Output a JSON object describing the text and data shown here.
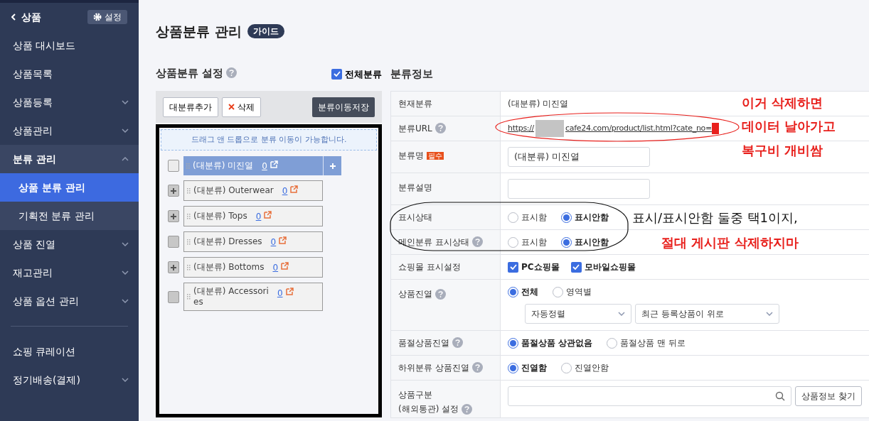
{
  "sidebar": {
    "back_label": "상품",
    "settings_label": "설정",
    "items": [
      {
        "label": "상품 대시보드"
      },
      {
        "label": "상품목록"
      },
      {
        "label": "상품등록",
        "expanded": false
      },
      {
        "label": "상품관리",
        "expanded": false
      },
      {
        "label": "분류 관리",
        "expanded": true,
        "children": [
          {
            "label": "상품 분류 관리",
            "selected": true
          },
          {
            "label": "기획전 분류 관리",
            "selected": false
          }
        ]
      },
      {
        "label": "상품 진열",
        "expanded": false
      },
      {
        "label": "재고관리",
        "expanded": false
      },
      {
        "label": "상품 옵션 관리",
        "expanded": false
      }
    ],
    "items_after_divider": [
      {
        "label": "쇼핑 큐레이션"
      },
      {
        "label": "정기배송(결제)",
        "expanded": false
      }
    ]
  },
  "page": {
    "title": "상품분류 관리",
    "guide_badge": "가이드"
  },
  "tree_panel": {
    "title": "상품분류 설정",
    "all_checkbox": {
      "label": "전체분류",
      "checked": true
    },
    "buttons": [
      {
        "label": "대분류추가"
      },
      {
        "label": "삭제"
      }
    ],
    "save_button": "분류이동저장",
    "hint": "드래그 앤 드롭으로 분류 이동이 가능합니다.",
    "nodes": [
      {
        "label": "(대분류) 미진열",
        "count": "0",
        "selected": true,
        "has_children": false
      },
      {
        "label": "(대분류) Outerwear",
        "count": "0",
        "selected": false,
        "has_children": true
      },
      {
        "label": "(대분류) Tops",
        "count": "0",
        "selected": false,
        "has_children": true
      },
      {
        "label": "(대분류) Dresses",
        "count": "0",
        "selected": false,
        "has_children": false
      },
      {
        "label": "(대분류) Bottoms",
        "count": "0",
        "selected": false,
        "has_children": true
      },
      {
        "label": "(대분류) Accessori\nes",
        "count": "0",
        "selected": false,
        "has_children": false
      }
    ]
  },
  "info_panel": {
    "title": "분류정보",
    "rows": [
      {
        "kind": "text",
        "label": "현재분류",
        "value": "(대분류) 미진열"
      },
      {
        "kind": "link",
        "label": "분류URL",
        "help": true,
        "url_start": "https://",
        "url_end": "cafe24.com/product/list.html?cate_no="
      },
      {
        "kind": "input",
        "label": "분류명",
        "required_badge": "필수",
        "value": "(대분류) 미진열"
      },
      {
        "kind": "input",
        "label": "분류설명",
        "value": ""
      },
      {
        "kind": "radio",
        "label": "표시상태",
        "options": [
          {
            "label": "표시함",
            "selected": false
          },
          {
            "label": "표시안함",
            "selected": true
          }
        ]
      },
      {
        "kind": "radio",
        "label": "메인분류 표시상태",
        "help": true,
        "options": [
          {
            "label": "표시함",
            "selected": false
          },
          {
            "label": "표시안함",
            "selected": true
          }
        ]
      },
      {
        "kind": "checkbox",
        "label": "쇼핑몰 표시설정",
        "options": [
          {
            "label": "PC쇼핑몰",
            "checked": true
          },
          {
            "label": "모바일쇼핑몰",
            "checked": true
          }
        ]
      },
      {
        "kind": "display",
        "label": "상품진열",
        "help": true,
        "options": [
          {
            "label": "전체",
            "selected": true
          },
          {
            "label": "영역별",
            "selected": false
          }
        ],
        "selects": [
          "자동정렬",
          "최근 등록상품이 위로"
        ]
      },
      {
        "kind": "radio",
        "label": "품절상품진열",
        "help": true,
        "options": [
          {
            "label": "품절상품 상관없음",
            "selected": true
          },
          {
            "label": "품절상품 맨 뒤로",
            "selected": false
          }
        ]
      },
      {
        "kind": "radio",
        "label": "하위분류 상품진열",
        "help": true,
        "options": [
          {
            "label": "진열함",
            "selected": true
          },
          {
            "label": "진열안함",
            "selected": false
          }
        ]
      },
      {
        "kind": "search",
        "label": "상품구분\n(해외통관) 설정",
        "help": true,
        "button": "상품정보 찾기"
      }
    ]
  },
  "annotations": [
    {
      "text": "이거 삭제하면",
      "color": "#e8201c"
    },
    {
      "text": "데이터 날아가고",
      "color": "#e8201c"
    },
    {
      "text": "복구비 개비쌈",
      "color": "#e8201c"
    },
    {
      "text": "표시/표시안함 둘중 택1이지,",
      "color": "#111111"
    },
    {
      "text": "절대 게시판 삭제하지마",
      "color": "#e8201c"
    }
  ]
}
